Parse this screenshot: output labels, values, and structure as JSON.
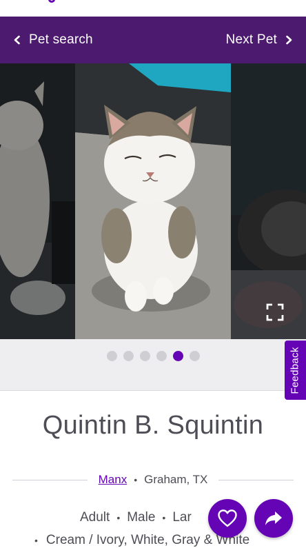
{
  "nav": {
    "back_label": "Pet search",
    "next_label": "Next Pet"
  },
  "gallery": {
    "photo_count": 6,
    "active_index": 4
  },
  "feedback_label": "Feedback",
  "pet": {
    "name": "Quintin B. Squintin",
    "breed": "Manx",
    "location": "Graham, TX",
    "age": "Adult",
    "sex": "Male",
    "size": "Lar",
    "colors": "Cream / Ivory, White, Gray & White"
  },
  "colors": {
    "brand_purple": "#6504b5",
    "header_purple": "#4c1a6e",
    "dot_inactive": "#cfcfd3"
  },
  "icons": {
    "back": "chevron-left-icon",
    "next": "chevron-right-icon",
    "expand": "expand-icon",
    "favorite": "heart-icon",
    "share": "share-arrow-icon"
  }
}
